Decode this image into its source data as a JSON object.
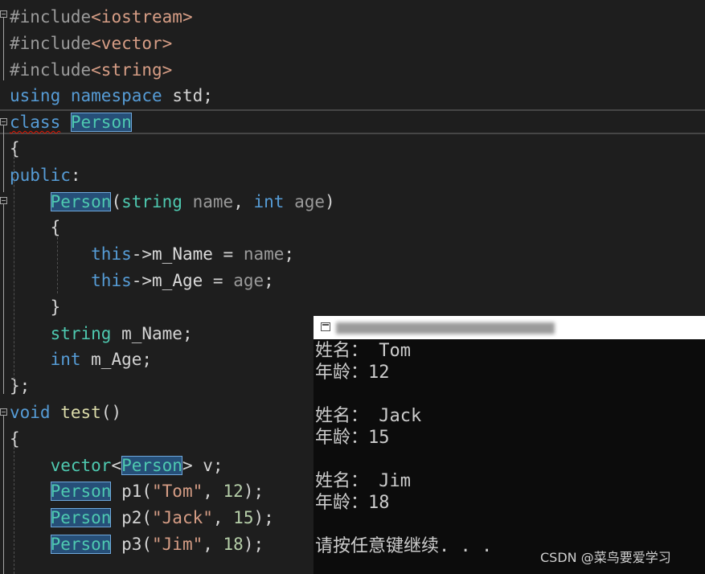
{
  "editor": {
    "lines": [
      {
        "parts": [
          {
            "t": "#include",
            "c": "pp"
          },
          {
            "t": "<iostream>",
            "c": "inc"
          }
        ]
      },
      {
        "parts": [
          {
            "t": "#include",
            "c": "pp"
          },
          {
            "t": "<vector>",
            "c": "inc"
          }
        ]
      },
      {
        "parts": [
          {
            "t": "#include",
            "c": "pp"
          },
          {
            "t": "<string>",
            "c": "inc"
          }
        ]
      },
      {
        "parts": [
          {
            "t": "using",
            "c": "kw"
          },
          {
            "t": " ",
            "c": "plain"
          },
          {
            "t": "namespace",
            "c": "kw"
          },
          {
            "t": " std;",
            "c": "plain"
          }
        ]
      },
      {
        "parts": [
          {
            "t": "class",
            "c": "kw squiggle"
          },
          {
            "t": " ",
            "c": "plain"
          },
          {
            "t": "Person",
            "c": "ty hl"
          }
        ]
      },
      {
        "parts": [
          {
            "t": "{",
            "c": "plain"
          }
        ]
      },
      {
        "parts": [
          {
            "t": "public",
            "c": "kw"
          },
          {
            "t": ":",
            "c": "plain"
          }
        ]
      },
      {
        "parts": [
          {
            "t": "    ",
            "c": "plain"
          },
          {
            "t": "Person",
            "c": "ty hl"
          },
          {
            "t": "(",
            "c": "plain"
          },
          {
            "t": "string",
            "c": "ty"
          },
          {
            "t": " ",
            "c": "plain"
          },
          {
            "t": "name",
            "c": "prm"
          },
          {
            "t": ", ",
            "c": "plain"
          },
          {
            "t": "int",
            "c": "kw"
          },
          {
            "t": " ",
            "c": "plain"
          },
          {
            "t": "age",
            "c": "prm"
          },
          {
            "t": ")",
            "c": "plain"
          }
        ]
      },
      {
        "parts": [
          {
            "t": "    {",
            "c": "plain"
          }
        ]
      },
      {
        "parts": [
          {
            "t": "        ",
            "c": "plain"
          },
          {
            "t": "this",
            "c": "kw"
          },
          {
            "t": "->",
            "c": "plain"
          },
          {
            "t": "m_Name",
            "c": "mem"
          },
          {
            "t": " = ",
            "c": "plain"
          },
          {
            "t": "name",
            "c": "prm"
          },
          {
            "t": ";",
            "c": "plain"
          }
        ]
      },
      {
        "parts": [
          {
            "t": "        ",
            "c": "plain"
          },
          {
            "t": "this",
            "c": "kw"
          },
          {
            "t": "->",
            "c": "plain"
          },
          {
            "t": "m_Age",
            "c": "mem"
          },
          {
            "t": " = ",
            "c": "plain"
          },
          {
            "t": "age",
            "c": "prm"
          },
          {
            "t": ";",
            "c": "plain"
          }
        ]
      },
      {
        "parts": [
          {
            "t": "    }",
            "c": "plain"
          }
        ]
      },
      {
        "parts": [
          {
            "t": "    ",
            "c": "plain"
          },
          {
            "t": "string",
            "c": "ty"
          },
          {
            "t": " m_Name;",
            "c": "plain"
          }
        ]
      },
      {
        "parts": [
          {
            "t": "    ",
            "c": "plain"
          },
          {
            "t": "int",
            "c": "kw"
          },
          {
            "t": " m_Age;",
            "c": "plain"
          }
        ]
      },
      {
        "parts": [
          {
            "t": "};",
            "c": "plain"
          }
        ]
      },
      {
        "parts": [
          {
            "t": "void",
            "c": "kw"
          },
          {
            "t": " ",
            "c": "plain"
          },
          {
            "t": "test",
            "c": "fn"
          },
          {
            "t": "()",
            "c": "plain"
          }
        ]
      },
      {
        "parts": [
          {
            "t": "{",
            "c": "plain"
          }
        ]
      },
      {
        "parts": [
          {
            "t": "    ",
            "c": "plain"
          },
          {
            "t": "vector",
            "c": "ty"
          },
          {
            "t": "<",
            "c": "plain"
          },
          {
            "t": "Person",
            "c": "ty hl"
          },
          {
            "t": "> v;",
            "c": "plain"
          }
        ]
      },
      {
        "parts": [
          {
            "t": "    ",
            "c": "plain"
          },
          {
            "t": "Person",
            "c": "ty hl"
          },
          {
            "t": " p1(",
            "c": "plain"
          },
          {
            "t": "\"Tom\"",
            "c": "str"
          },
          {
            "t": ", ",
            "c": "plain"
          },
          {
            "t": "12",
            "c": "num"
          },
          {
            "t": ");",
            "c": "plain"
          }
        ]
      },
      {
        "parts": [
          {
            "t": "    ",
            "c": "plain"
          },
          {
            "t": "Person",
            "c": "ty hl"
          },
          {
            "t": " p2(",
            "c": "plain"
          },
          {
            "t": "\"Jack\"",
            "c": "str"
          },
          {
            "t": ", ",
            "c": "plain"
          },
          {
            "t": "15",
            "c": "num"
          },
          {
            "t": ");",
            "c": "plain"
          }
        ]
      },
      {
        "parts": [
          {
            "t": "    ",
            "c": "plain"
          },
          {
            "t": "Person",
            "c": "ty hl"
          },
          {
            "t": " p3(",
            "c": "plain"
          },
          {
            "t": "\"Jim\"",
            "c": "str"
          },
          {
            "t": ", ",
            "c": "plain"
          },
          {
            "t": "18",
            "c": "num"
          },
          {
            "t": ");",
            "c": "plain"
          }
        ]
      }
    ]
  },
  "console": {
    "output": [
      "姓名： Tom",
      "年龄：12",
      "",
      "姓名： Jack",
      "年龄：15",
      "",
      "姓名： Jim",
      "年龄：18",
      "",
      "请按任意键继续. . ."
    ]
  },
  "watermark": "CSDN @菜鸟要爱学习",
  "colors": {
    "background": "#1e1e1e",
    "keyword": "#569cd6",
    "type": "#4ec9b0",
    "console_background": "#0c0c0c"
  },
  "icons": [
    "fold-collapse-icon",
    "console-app-icon"
  ]
}
